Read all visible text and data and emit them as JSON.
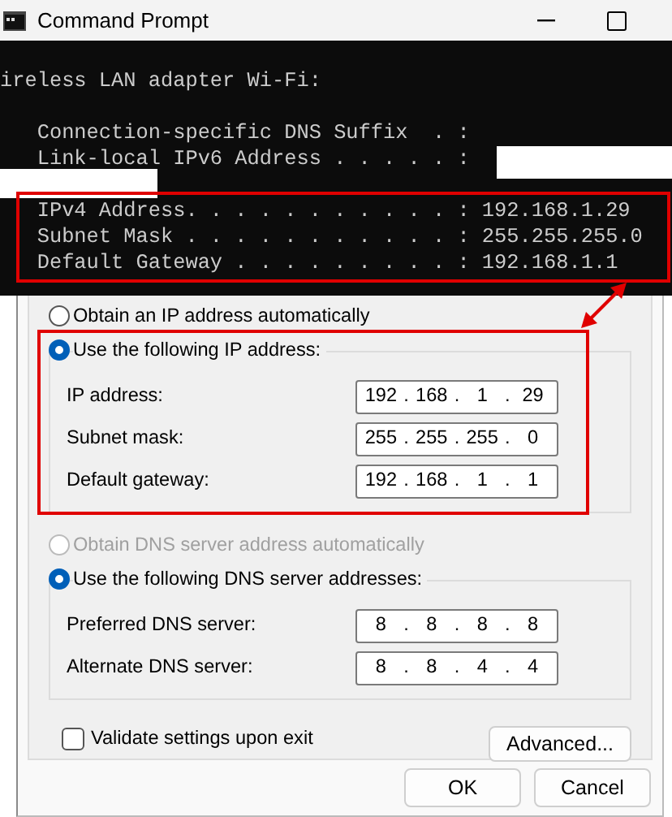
{
  "window": {
    "title": "Command Prompt"
  },
  "console": {
    "lines": [
      {
        "kind": "text",
        "text": "ireless LAN adapter Wi-Fi:"
      },
      {
        "kind": "blank"
      },
      {
        "kind": "text",
        "text": "   Connection-specific DNS Suffix  . :"
      },
      {
        "kind": "text",
        "text": "   Link-local IPv6 Address . . . . . :",
        "redacted": true
      },
      {
        "kind": "redacted"
      },
      {
        "kind": "text",
        "text": "   IPv4 Address. . . . . . . . . . . : 192.168.1.29",
        "boxed": true
      },
      {
        "kind": "text",
        "text": "   Subnet Mask . . . . . . . . . . . : 255.255.255.0",
        "boxed": true
      },
      {
        "kind": "text",
        "text": "   Default Gateway . . . . . . . . . : 192.168.1.1",
        "boxed": true
      }
    ]
  },
  "dialog": {
    "separator": ".",
    "ip_options": [
      {
        "label": "Obtain an IP address automatically",
        "selected": false,
        "disabled": false
      },
      {
        "label": "Use the following IP address:",
        "selected": true,
        "disabled": false
      }
    ],
    "ip_fields": [
      {
        "label": "IP address:",
        "octets": [
          "192",
          "168",
          "1",
          "29"
        ]
      },
      {
        "label": "Subnet mask:",
        "octets": [
          "255",
          "255",
          "255",
          "0"
        ]
      },
      {
        "label": "Default gateway:",
        "octets": [
          "192",
          "168",
          "1",
          "1"
        ]
      }
    ],
    "dns_options": [
      {
        "label": "Obtain DNS server address automatically",
        "selected": false,
        "disabled": true
      },
      {
        "label": "Use the following DNS server addresses:",
        "selected": true,
        "disabled": false
      }
    ],
    "dns_fields": [
      {
        "label": "Preferred DNS server:",
        "octets": [
          "8",
          "8",
          "8",
          "8"
        ]
      },
      {
        "label": "Alternate DNS server:",
        "octets": [
          "8",
          "8",
          "4",
          "4"
        ]
      }
    ],
    "validate": {
      "label": "Validate settings upon exit",
      "checked": false
    },
    "advanced_button": "Advanced...",
    "buttons": [
      "OK",
      "Cancel"
    ]
  }
}
